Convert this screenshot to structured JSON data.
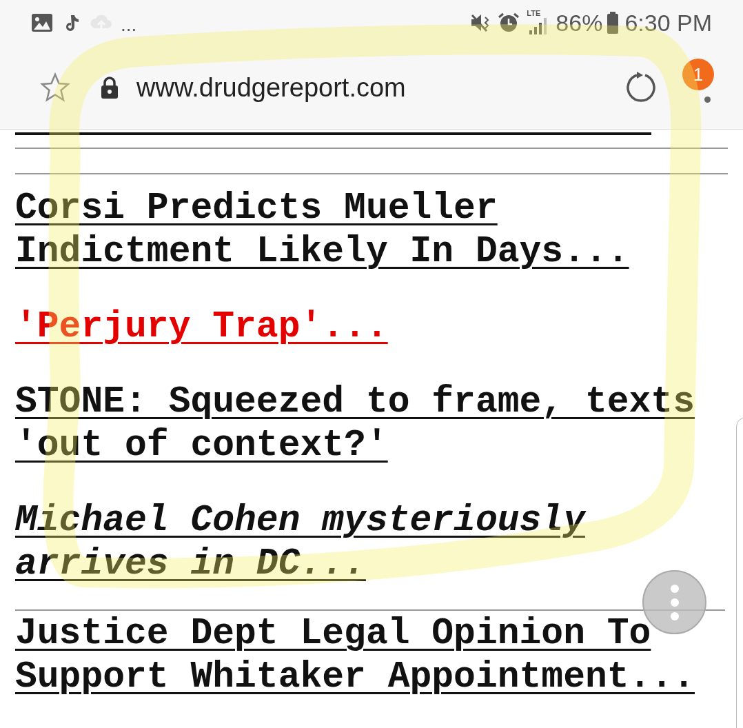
{
  "status_bar": {
    "more": "...",
    "network": "LTE",
    "battery": "86%",
    "time": "6:30 PM"
  },
  "address_bar": {
    "url": "www.drudgereport.com",
    "notification_badge": "1"
  },
  "headlines": [
    {
      "text": "Corsi Predicts Mueller Indictment Likely In Days...",
      "kind": "plain"
    },
    {
      "text": "'Perjury Trap'...",
      "kind": "red"
    },
    {
      "text": "STONE: Squeezed to frame, texts 'out of context?'",
      "kind": "plain"
    },
    {
      "text": "Michael Cohen mysteriously arrives in DC...",
      "kind": "italic"
    },
    {
      "text": "Justice Dept Legal Opinion To Support Whitaker Appointment...",
      "kind": "plain"
    }
  ]
}
